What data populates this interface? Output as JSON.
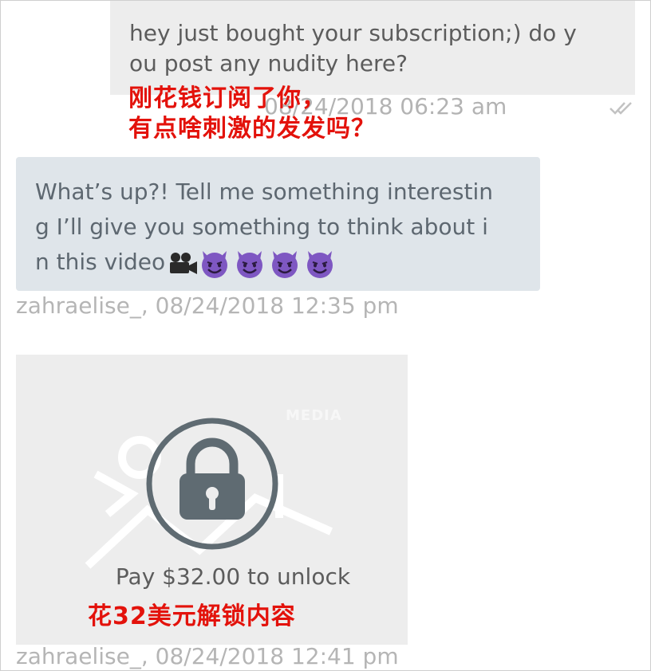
{
  "messages": {
    "outgoing": {
      "text": "hey just bought your subscription;) do y\nou post any nudity here?",
      "timestamp": "08/24/2018 06:23 am",
      "status_icon": "double-check-icon",
      "caption_zh": "刚花钱订阅了你，\n有点啥刺激的发发吗？"
    },
    "incoming": {
      "text": "What’s up?! Tell me something interestin\ng I’ll give you something to think about i\nn this video",
      "emojis": [
        "movie-camera-icon",
        "smiling-devil-icon",
        "smiling-devil-icon",
        "smiling-devil-icon",
        "smiling-devil-icon"
      ],
      "meta": "zahraelise_, 08/24/2018 12:35 pm"
    },
    "media": {
      "watermark": "MEDIA",
      "lock_icon": "lock-icon",
      "pay_label": "Pay $32.00 to unlock",
      "caption_zh": "花32美元解锁内容",
      "meta": "zahraelise_, 08/24/2018 12:41 pm"
    }
  },
  "colors": {
    "outgoing_bg": "#ededed",
    "incoming_bg": "#dfe5ea",
    "caption_red": "#e3120b",
    "lock_gray": "#5f6b72",
    "meta_gray": "#b5b5b5"
  }
}
